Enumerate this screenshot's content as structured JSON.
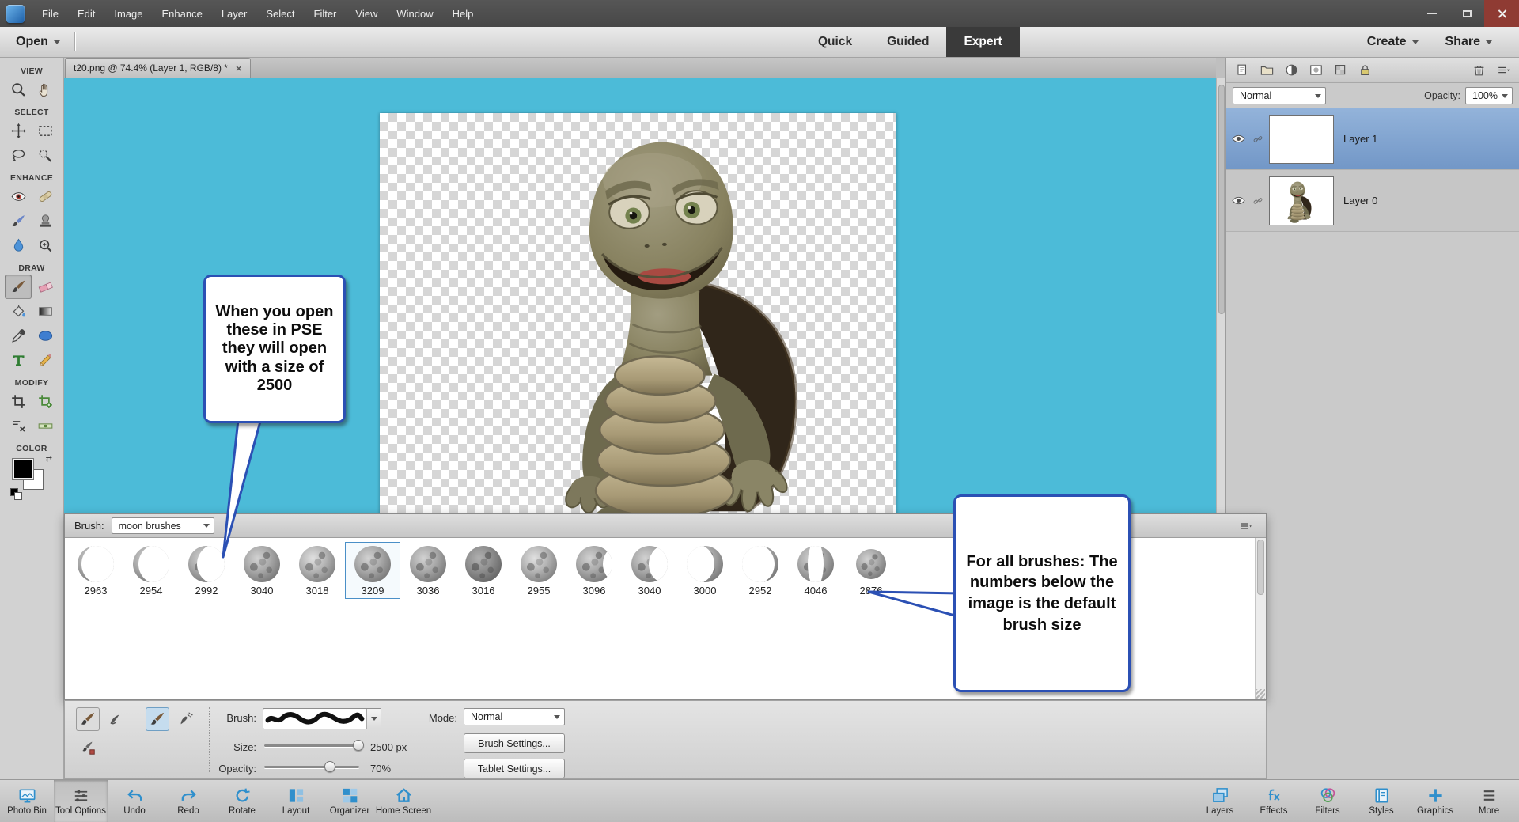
{
  "colors": {
    "canvas_bg": "#4cbbd8",
    "callout_border": "#2b50b4",
    "selected_layer": "#7aa0cf",
    "accent_blue": "#2f8fcc"
  },
  "menubar": {
    "items": [
      "File",
      "Edit",
      "Image",
      "Enhance",
      "Layer",
      "Select",
      "Filter",
      "View",
      "Window",
      "Help"
    ],
    "window_controls": [
      "minimize",
      "maximize",
      "close"
    ]
  },
  "header": {
    "open_label": "Open",
    "mode_tabs": [
      {
        "label": "Quick",
        "active": false
      },
      {
        "label": "Guided",
        "active": false
      },
      {
        "label": "Expert",
        "active": true
      }
    ],
    "create_label": "Create",
    "share_label": "Share"
  },
  "document_bar": {
    "tab_label": "t20.png @ 74.4% (Layer 1, RGB/8) *",
    "close_glyph": "×"
  },
  "toolbox": {
    "sections": [
      {
        "label": "VIEW",
        "tools": [
          {
            "icon": "zoom"
          },
          {
            "icon": "hand"
          }
        ]
      },
      {
        "label": "SELECT",
        "tools": [
          {
            "icon": "move"
          },
          {
            "icon": "marquee"
          },
          {
            "icon": "lasso"
          },
          {
            "icon": "quick-select"
          }
        ]
      },
      {
        "label": "ENHANCE",
        "tools": [
          {
            "icon": "red-eye"
          },
          {
            "icon": "spot-heal"
          },
          {
            "icon": "smart-brush"
          },
          {
            "icon": "clone-stamp"
          },
          {
            "icon": "blur"
          },
          {
            "icon": "sharpen"
          }
        ]
      },
      {
        "label": "DRAW",
        "tools": [
          {
            "icon": "brush",
            "selected": true
          },
          {
            "icon": "eraser"
          },
          {
            "icon": "paint-bucket"
          },
          {
            "icon": "gradient"
          },
          {
            "icon": "eyedropper"
          },
          {
            "icon": "shape"
          },
          {
            "icon": "type"
          },
          {
            "icon": "pencil"
          }
        ]
      },
      {
        "label": "MODIFY",
        "tools": [
          {
            "icon": "crop"
          },
          {
            "icon": "recompose"
          },
          {
            "icon": "content-move"
          },
          {
            "icon": "straighten"
          }
        ]
      },
      {
        "label": "COLOR",
        "tools": []
      }
    ]
  },
  "callouts": {
    "size_note": "When you open these in PSE they will open with a size of 2500",
    "brush_note": "For all brushes: The numbers below the image is the default brush size"
  },
  "brush_panel": {
    "brush_label": "Brush:",
    "preset_value": "moon brushes",
    "brushes": [
      {
        "size": "2963",
        "phase": "c-l1"
      },
      {
        "size": "2954",
        "phase": "c-l2"
      },
      {
        "size": "2992",
        "phase": "c-l3"
      },
      {
        "size": "3040",
        "phase": "full-a"
      },
      {
        "size": "3018",
        "phase": "full-b"
      },
      {
        "size": "3209",
        "phase": "full-c",
        "selected": true
      },
      {
        "size": "3036",
        "phase": "full-a"
      },
      {
        "size": "3016",
        "phase": "full-d"
      },
      {
        "size": "2955",
        "phase": "full-b"
      },
      {
        "size": "3096",
        "phase": "gib-r"
      },
      {
        "size": "3040",
        "phase": "half-r"
      },
      {
        "size": "3000",
        "phase": "c-r3"
      },
      {
        "size": "2952",
        "phase": "c-r1"
      },
      {
        "size": "4046",
        "phase": "ring"
      },
      {
        "size": "2876",
        "phase": "full-sm"
      }
    ]
  },
  "tool_options": {
    "brush_label": "Brush:",
    "mode_label": "Mode:",
    "mode_value": "Normal",
    "size_label": "Size:",
    "size_value": "2500 px",
    "size_pct": 100,
    "opacity_label": "Opacity:",
    "opacity_value": "70%",
    "opacity_pct": 70,
    "brush_settings_label": "Brush Settings...",
    "tablet_settings_label": "Tablet Settings..."
  },
  "taskbar": {
    "left": [
      {
        "label": "Photo Bin",
        "icon": "photo-bin"
      },
      {
        "label": "Tool Options",
        "icon": "tool-options",
        "active": true
      },
      {
        "label": "Undo",
        "icon": "undo"
      },
      {
        "label": "Redo",
        "icon": "redo"
      },
      {
        "label": "Rotate",
        "icon": "rotate"
      },
      {
        "label": "Layout",
        "icon": "layout"
      },
      {
        "label": "Organizer",
        "icon": "organizer"
      },
      {
        "label": "Home Screen",
        "icon": "home"
      }
    ],
    "right": [
      {
        "label": "Layers",
        "icon": "layers"
      },
      {
        "label": "Effects",
        "icon": "effects"
      },
      {
        "label": "Filters",
        "icon": "filters"
      },
      {
        "label": "Styles",
        "icon": "styles"
      },
      {
        "label": "Graphics",
        "icon": "graphics"
      },
      {
        "label": "More",
        "icon": "more"
      }
    ]
  },
  "layers_panel": {
    "blend_mode": "Normal",
    "opacity_label": "Opacity:",
    "opacity_value": "100%",
    "action_icons": [
      "new-layer",
      "new-group",
      "adjustment-layer",
      "layer-mask",
      "lock-transparent",
      "lock-all"
    ],
    "layers": [
      {
        "name": "Layer 1",
        "selected": true,
        "thumb": "empty"
      },
      {
        "name": "Layer 0",
        "selected": false,
        "thumb": "turtle"
      }
    ]
  }
}
